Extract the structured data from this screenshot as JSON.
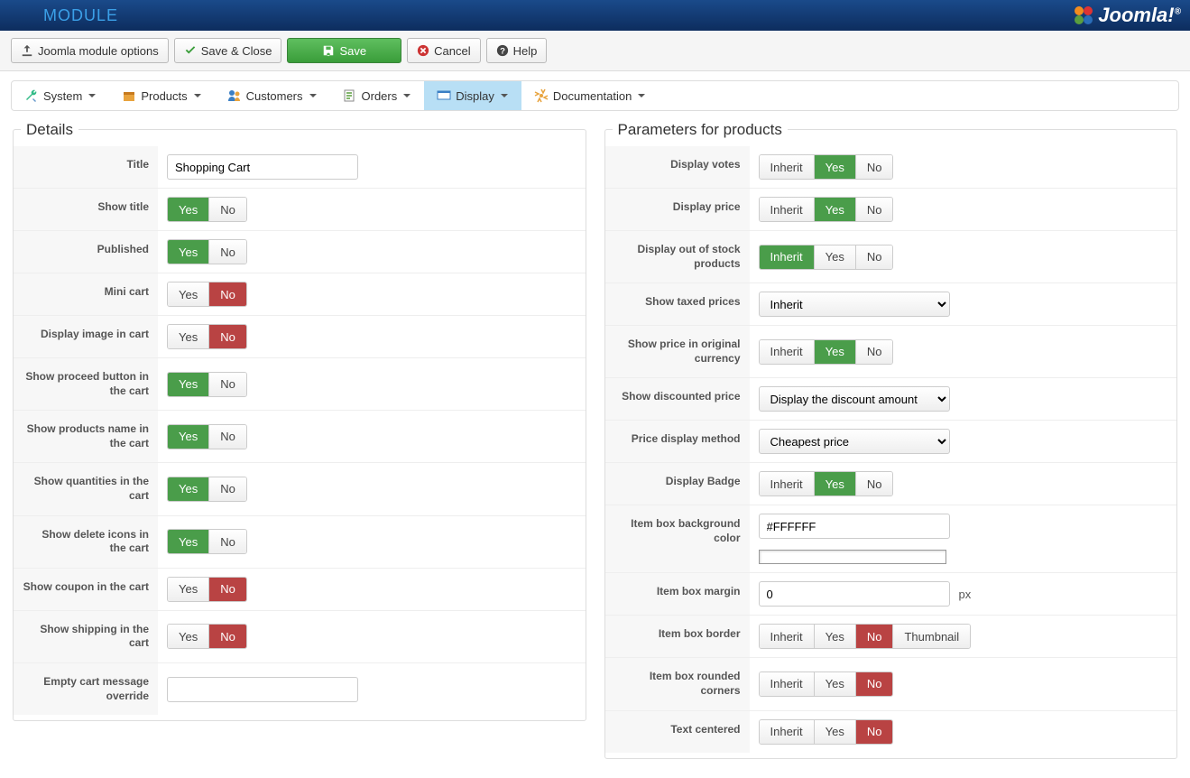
{
  "header": {
    "module_title": "MODULE",
    "joomla": "Joomla!"
  },
  "toolbar": {
    "options": "Joomla module options",
    "save_close": "Save & Close",
    "save": "Save",
    "cancel": "Cancel",
    "help": "Help"
  },
  "menubar": {
    "system": "System",
    "products": "Products",
    "customers": "Customers",
    "orders": "Orders",
    "display": "Display",
    "documentation": "Documentation"
  },
  "radio": {
    "yes": "Yes",
    "no": "No",
    "inherit": "Inherit",
    "thumbnail": "Thumbnail"
  },
  "details": {
    "legend": "Details",
    "title_label": "Title",
    "title_value": "Shopping Cart",
    "show_title_label": "Show title",
    "show_title": "yes",
    "published_label": "Published",
    "published": "yes",
    "mini_cart_label": "Mini cart",
    "mini_cart": "no",
    "display_image_label": "Display image in cart",
    "display_image": "no",
    "proceed_btn_label": "Show proceed button in the cart",
    "proceed_btn": "yes",
    "products_name_label": "Show products name in the cart",
    "products_name": "yes",
    "quantities_label": "Show quantities in the cart",
    "quantities": "yes",
    "delete_icons_label": "Show delete icons in the cart",
    "delete_icons": "yes",
    "coupon_label": "Show coupon in the cart",
    "coupon": "no",
    "shipping_label": "Show shipping in the cart",
    "shipping": "no",
    "empty_msg_label": "Empty cart message override",
    "empty_msg_value": ""
  },
  "params": {
    "legend": "Parameters for products",
    "display_votes_label": "Display votes",
    "display_votes": "yes",
    "display_price_label": "Display price",
    "display_price": "yes",
    "out_of_stock_label": "Display out of stock products",
    "out_of_stock": "inherit",
    "taxed_prices_label": "Show taxed prices",
    "taxed_prices_value": "Inherit",
    "orig_currency_label": "Show price in original currency",
    "orig_currency": "yes",
    "discounted_label": "Show discounted price",
    "discounted_value": "Display the discount amount",
    "price_method_label": "Price display method",
    "price_method_value": "Cheapest price",
    "display_badge_label": "Display Badge",
    "display_badge": "yes",
    "bg_color_label": "Item box background color",
    "bg_color_value": "#FFFFFF",
    "margin_label": "Item box margin",
    "margin_value": "0",
    "margin_suffix": "px",
    "border_label": "Item box border",
    "border": "no",
    "rounded_label": "Item box rounded corners",
    "rounded": "no",
    "centered_label": "Text centered",
    "centered": "no"
  }
}
